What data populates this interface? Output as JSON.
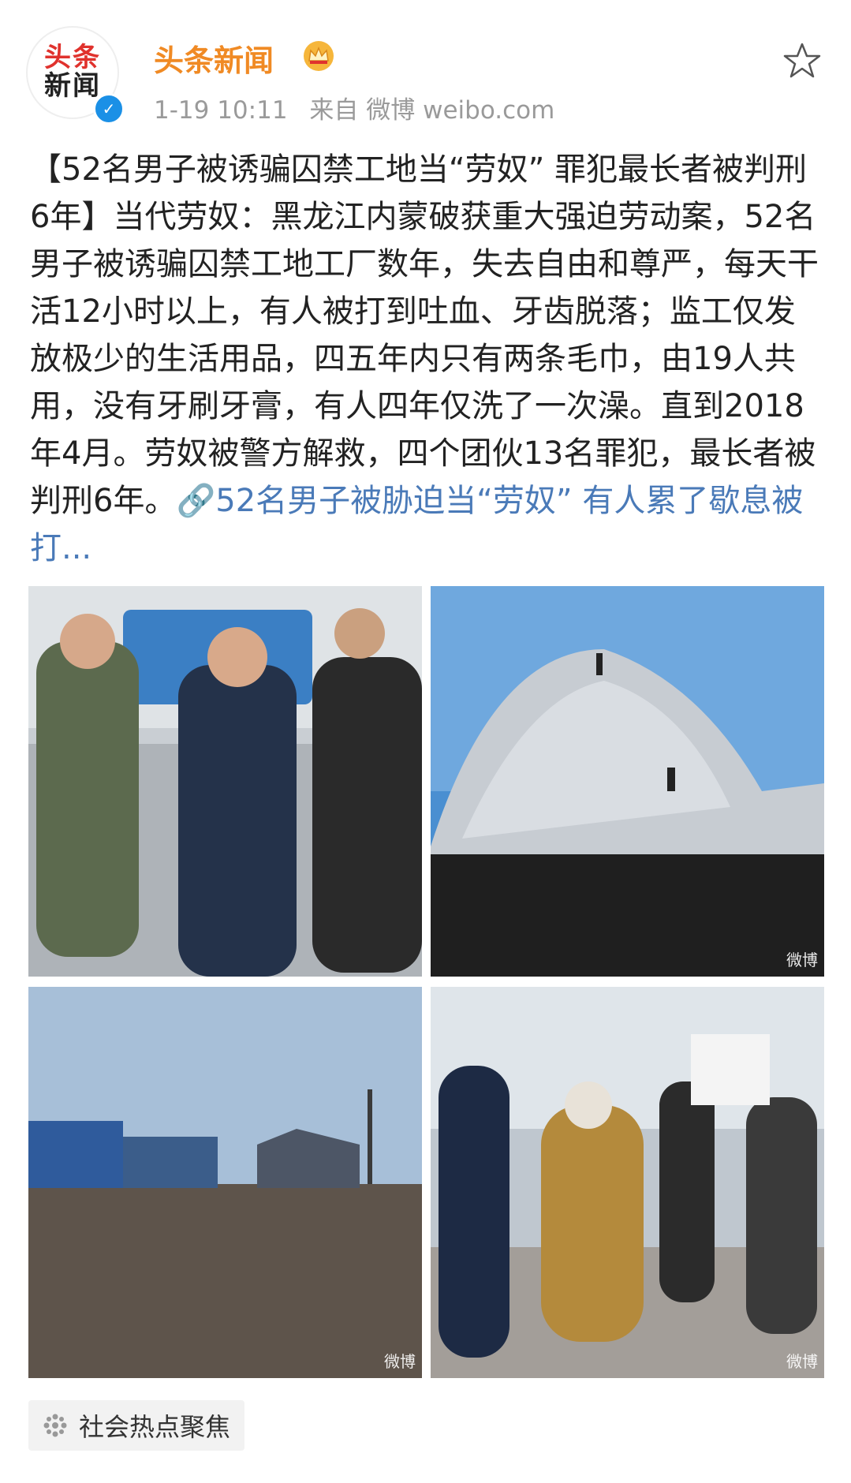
{
  "header": {
    "avatar_line1": "头条",
    "avatar_line2": "新闻",
    "verified_mark": "✓",
    "username": "头条新闻",
    "timestamp": "1-19 10:11",
    "source": "来自 微博 weibo.com",
    "favorite_icon": "star-outline-icon",
    "badge_icon": "crown-icon"
  },
  "post": {
    "text": "【52名男子被诱骗囚禁工地当“劳奴” 罪犯最长者被判刑6年】当代劳奴：黑龙江内蒙破获重大强迫劳动案，52名男子被诱骗囚禁工地工厂数年，失去自由和尊严，每天干活12小时以上，有人被打到吐血、牙齿脱落；监工仅发放极少的生活用品，四五年内只有两条毛巾，由19人共用，没有牙刷牙膏，有人四年仅洗了一次澡。直到2018年4月。劳奴被警方解救，四个团伙13名罪犯，最长者被判刑6年。",
    "link_text": "🔗52名男子被胁迫当“劳奴” 有人累了歇息被打...",
    "link_color": "#4a7ab8"
  },
  "images": {
    "watermark": "微博"
  },
  "topic_tag": {
    "label": "社会热点聚焦",
    "icon": "hot-topic-icon"
  },
  "colors": {
    "username": "#f08a24",
    "meta": "#9a9a9a",
    "verified": "#1b90e6"
  }
}
